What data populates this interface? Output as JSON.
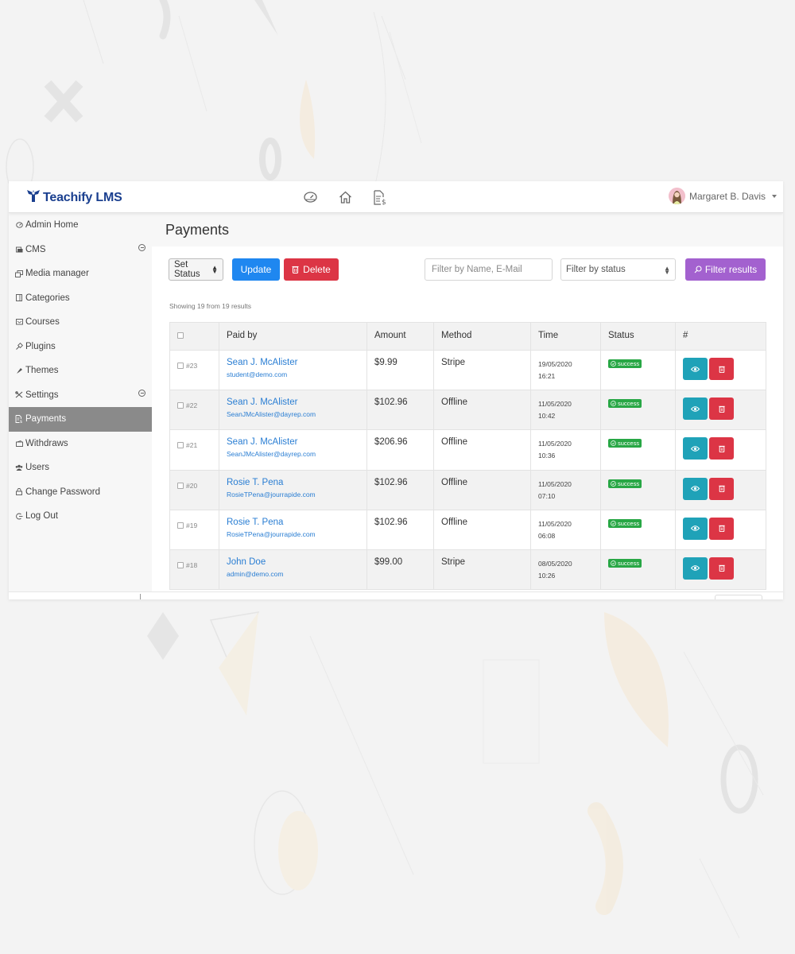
{
  "app": {
    "brand": "Teachify LMS",
    "top_icons": [
      "dashboard-icon",
      "home-icon",
      "payments-icon"
    ],
    "user": {
      "name": "Margaret B. Davis"
    }
  },
  "sidebar": {
    "items": [
      {
        "label": "Admin Home",
        "icon": "gauge-icon",
        "active": false,
        "expandable": false
      },
      {
        "label": "CMS",
        "icon": "cms-icon",
        "active": false,
        "expandable": true
      },
      {
        "label": "Media manager",
        "icon": "media-icon",
        "active": false,
        "expandable": false
      },
      {
        "label": "Categories",
        "icon": "categories-icon",
        "active": false,
        "expandable": false
      },
      {
        "label": "Courses",
        "icon": "courses-icon",
        "active": false,
        "expandable": false
      },
      {
        "label": "Plugins",
        "icon": "plugin-icon",
        "active": false,
        "expandable": false
      },
      {
        "label": "Themes",
        "icon": "brush-icon",
        "active": false,
        "expandable": false
      },
      {
        "label": "Settings",
        "icon": "tools-icon",
        "active": false,
        "expandable": true
      },
      {
        "label": "Payments",
        "icon": "invoice-icon",
        "active": true,
        "expandable": false
      },
      {
        "label": "Withdraws",
        "icon": "wallet-icon",
        "active": false,
        "expandable": false
      },
      {
        "label": "Users",
        "icon": "users-icon",
        "active": false,
        "expandable": false
      },
      {
        "label": "Change Password",
        "icon": "lock-icon",
        "active": false,
        "expandable": false
      },
      {
        "label": "Log Out",
        "icon": "logout-icon",
        "active": false,
        "expandable": false
      }
    ]
  },
  "page": {
    "title": "Payments",
    "toolbar": {
      "set_status_label": "Set Status",
      "update_label": "Update",
      "delete_label": "Delete",
      "filter_input_placeholder": "Filter by Name, E-Mail",
      "filter_input_value": "",
      "status_select_value": "Filter by status",
      "filter_button_label": "Filter results"
    },
    "result_count": "Showing 19 from 19 results"
  },
  "table": {
    "columns": [
      "",
      "Paid by",
      "Amount",
      "Method",
      "Time",
      "Status",
      "#"
    ],
    "rows": [
      {
        "id": "#23",
        "name": "Sean J. McAlister",
        "email": "student@demo.com",
        "amount": "$9.99",
        "method": "Stripe",
        "date": "19/05/2020",
        "time": "16:21",
        "status": "success"
      },
      {
        "id": "#22",
        "name": "Sean J. McAlister",
        "email": "SeanJMcAlister@dayrep.com",
        "amount": "$102.96",
        "method": "Offline",
        "date": "11/05/2020",
        "time": "10:42",
        "status": "success"
      },
      {
        "id": "#21",
        "name": "Sean J. McAlister",
        "email": "SeanJMcAlister@dayrep.com",
        "amount": "$206.96",
        "method": "Offline",
        "date": "11/05/2020",
        "time": "10:36",
        "status": "success"
      },
      {
        "id": "#20",
        "name": "Rosie T. Pena",
        "email": "RosieTPena@jourrapide.com",
        "amount": "$102.96",
        "method": "Offline",
        "date": "11/05/2020",
        "time": "07:10",
        "status": "success"
      },
      {
        "id": "#19",
        "name": "Rosie T. Pena",
        "email": "RosieTPena@jourrapide.com",
        "amount": "$102.96",
        "method": "Offline",
        "date": "11/05/2020",
        "time": "06:08",
        "status": "success"
      },
      {
        "id": "#18",
        "name": "John Doe",
        "email": "admin@demo.com",
        "amount": "$99.00",
        "method": "Stripe",
        "date": "08/05/2020",
        "time": "10:26",
        "status": "success"
      }
    ]
  },
  "colors": {
    "brand": "#1a3f8f",
    "primary": "#1f87f0",
    "danger": "#dc3545",
    "filter": "#a361cf",
    "info": "#1fa2b8",
    "success": "#28a745",
    "link": "#2a7ed3",
    "sidebar_active": "#8a8a8a"
  }
}
